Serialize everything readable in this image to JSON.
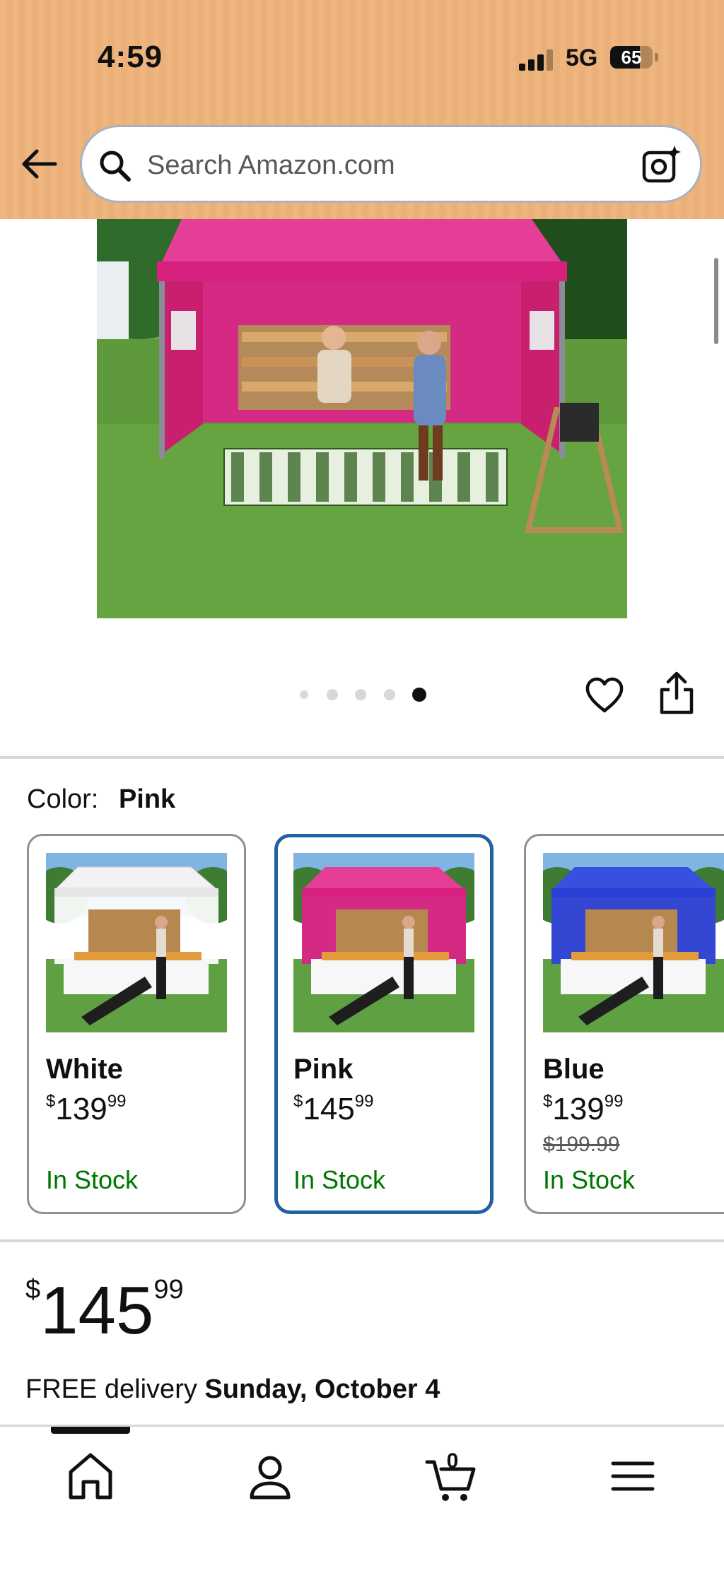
{
  "status_bar": {
    "time": "4:59",
    "network": "5G",
    "battery": "65"
  },
  "search": {
    "placeholder": "Search Amazon.com"
  },
  "gallery": {
    "image_count": 5,
    "active_index": 5
  },
  "color_selector": {
    "label": "Color:",
    "selected": "Pink",
    "options": [
      {
        "name": "White",
        "price_dollars": "139",
        "price_cents": "99",
        "list_price": "",
        "stock": "In Stock",
        "color": "#f2f2f2"
      },
      {
        "name": "Pink",
        "price_dollars": "145",
        "price_cents": "99",
        "list_price": "",
        "stock": "In Stock",
        "color": "#e2187f"
      },
      {
        "name": "Blue",
        "price_dollars": "139",
        "price_cents": "99",
        "list_price": "$199.99",
        "stock": "In Stock",
        "color": "#2a3fd6"
      }
    ]
  },
  "price": {
    "currency": "$",
    "dollars": "145",
    "cents": "99"
  },
  "delivery": {
    "prefix": "FREE delivery",
    "date": "Sunday, October 4"
  },
  "bottom_nav": {
    "cart_count": "0",
    "active": "home"
  },
  "colors": {
    "header_bg": "#eeb57e",
    "selected_border": "#2162a1",
    "in_stock": "#007600"
  }
}
